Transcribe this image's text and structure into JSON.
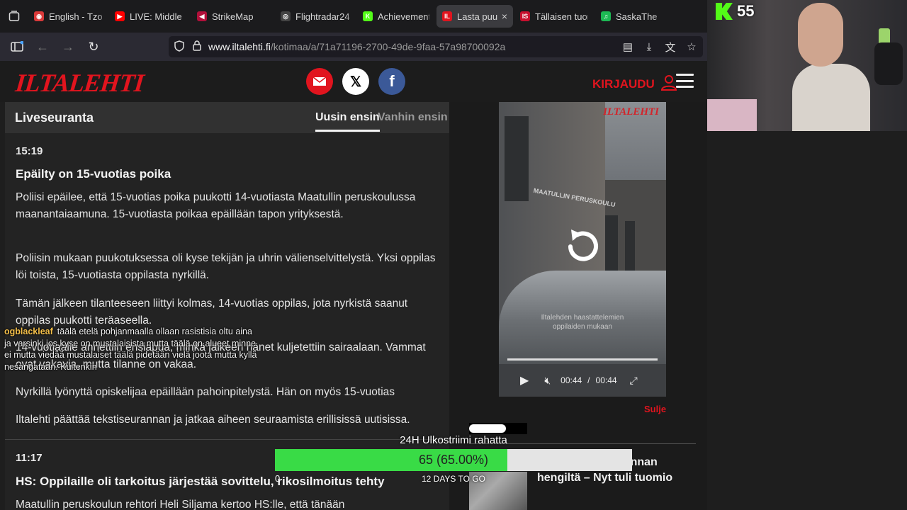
{
  "browser": {
    "tabs": [
      {
        "label": "English - Tzot",
        "color": "#d93a3a",
        "glyph": "◉",
        "active": false
      },
      {
        "label": "LIVE: Middle E",
        "color": "#ff0000",
        "glyph": "▶",
        "active": false
      },
      {
        "label": "StrikeMap",
        "color": "#b0103a",
        "glyph": "◀",
        "active": false
      },
      {
        "label": "Flightradar24",
        "color": "#444444",
        "glyph": "◎",
        "active": false
      },
      {
        "label": "Achievements",
        "color": "#53fc18",
        "glyph": "K",
        "active": false
      },
      {
        "label": "Lasta puuk",
        "color": "#e1141e",
        "glyph": "IL",
        "active": true
      },
      {
        "label": "Tällaisen tuom",
        "color": "#c8102e",
        "glyph": "IS",
        "active": false
      },
      {
        "label": "SaskaTheBle",
        "color": "#1db954",
        "glyph": "♫",
        "active": false
      }
    ],
    "url_host": "www.iltalehti.fi",
    "url_path": "/kotimaa/a/71a71196-2700-49de-9faa-57a98700092a"
  },
  "site": {
    "logo": "ILTALEHTI",
    "login": "KIRJAUDU"
  },
  "live": {
    "title": "Liveseuranta",
    "sort_new": "Uusin ensin",
    "sort_old": "Vanhin ensin",
    "entries": [
      {
        "time": "15:19",
        "headline": "Epäilty on 15-vuotias poika",
        "paragraphs": [
          "Poliisi epäilee, että 15-vuotias poika puukotti 14-vuotiasta Maatullin peruskoulussa maanantaiaamuna. 15-vuotiasta poikaa epäillään tapon yrityksestä.",
          "Poliisin mukaan puukotuksessa oli kyse tekijän ja uhrin välienselvittelystä. Yksi oppilas löi toista, 15-vuotiasta oppilasta nyrkillä.",
          "Tämän jälkeen tilanteeseen liittyi kolmas, 14-vuotias oppilas, jota nyrkistä saanut oppilas puukotti teräaseella.",
          "14-vuotiaalle annettiin ensiapua, minkä jälkeen hänet kuljetettiin sairaalaan. Vammat ovat vakavia, mutta tilanne on vakaa.",
          "Nyrkillä lyönyttä opiskelijaa epäillään pahoinpitelystä. Hän on myös 15-vuotias",
          "Iltalehti päättää tekstiseurannan ja jatkaa aiheen seuraamista erillisissä uutisissa."
        ]
      },
      {
        "time": "11:17",
        "headline": "HS: Oppilaille oli tarkoitus järjestää sovittelu, rikosilmoitus tehty",
        "paragraphs": [
          "Maatullin peruskoulun rehtori Heli Siljama kertoo HS:lle, että tänään"
        ]
      }
    ]
  },
  "video": {
    "watermark": "ILTALEHTI",
    "sign_text": "MAATULLIN PERUSKOULU",
    "caption_line1": "Iltalehden haastattelemien",
    "caption_line2": "oppilaiden mukaan",
    "time_current": "00:44",
    "time_sep": "/",
    "time_total": "00:44",
    "close_label": "Sulje"
  },
  "related": {
    "title": "…ski ajoi pariskunnan hengiltä – Nyt tuli tuomio"
  },
  "stream": {
    "kick_count": "55",
    "chat": {
      "user": "ogblackleaf",
      "lines": [
        "täälä etelä pohjanmaalla ollaan rasistisia oltu aina",
        "ja varsinki jos kyse on mustalaisista mutta täälä on alueet minne",
        "ei mutta viedää mustalaiset täälä pidetään vielä joota mutta kyllä",
        "nesangataan. Kuitenkin"
      ]
    },
    "goal": {
      "label": "24H Ulkostriimi rahatta",
      "value_text": "65 (65.00%)",
      "progress": 0.65,
      "start": "0",
      "days": "12 DAYS TO GO"
    }
  }
}
